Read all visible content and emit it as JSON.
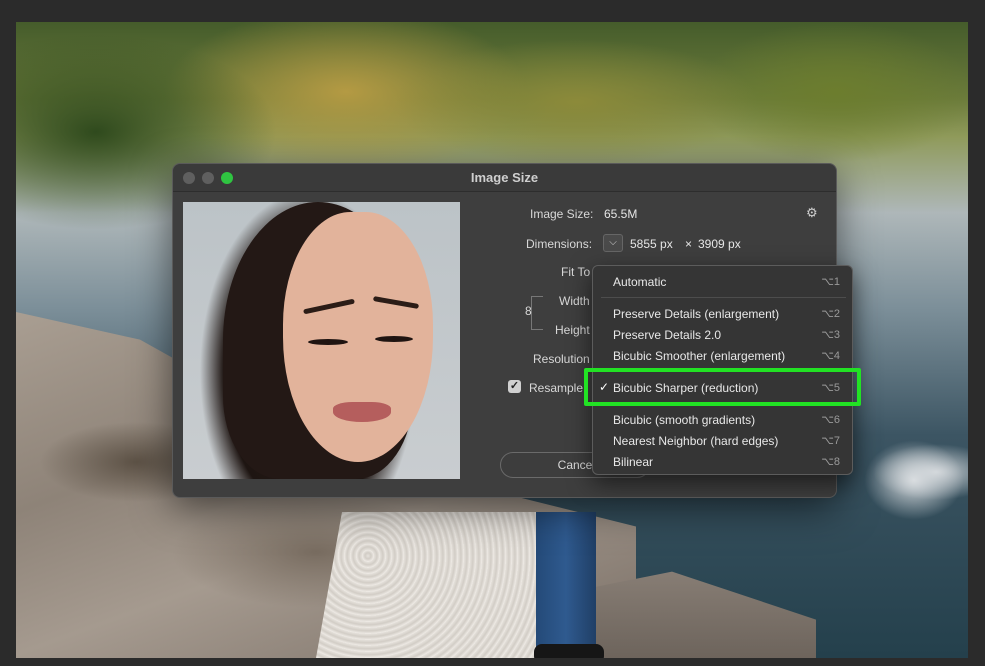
{
  "dialog": {
    "title": "Image Size",
    "image_size_label": "Image Size:",
    "image_size_value": "65.5M",
    "dimensions_label": "Dimensions:",
    "dimensions_width": "5855 px",
    "dimensions_x": "×",
    "dimensions_height": "3909 px",
    "fit_to_label": "Fit To",
    "width_label": "Width",
    "height_label": "Height",
    "resolution_label": "Resolution",
    "resample_label": "Resample",
    "resample_checked": "✓",
    "cancel_label": "Cance",
    "gear_icon": "⚙",
    "dropdown_icon": "⌵",
    "link_icon": "8"
  },
  "menu": {
    "items": [
      {
        "label": "Automatic",
        "key": "⌥1"
      },
      {
        "label": "Preserve Details (enlargement)",
        "key": "⌥2"
      },
      {
        "label": "Preserve Details 2.0",
        "key": "⌥3"
      },
      {
        "label": "Bicubic Smoother (enlargement)",
        "key": "⌥4"
      },
      {
        "label": "Bicubic Sharper (reduction)",
        "key": "⌥5",
        "check": "✓"
      },
      {
        "label": "Bicubic (smooth gradients)",
        "key": "⌥6"
      },
      {
        "label": "Nearest Neighbor (hard edges)",
        "key": "⌥7"
      },
      {
        "label": "Bilinear",
        "key": "⌥8"
      }
    ]
  },
  "colors": {
    "highlight": "#22e224",
    "traffic_green": "#2fc441"
  }
}
